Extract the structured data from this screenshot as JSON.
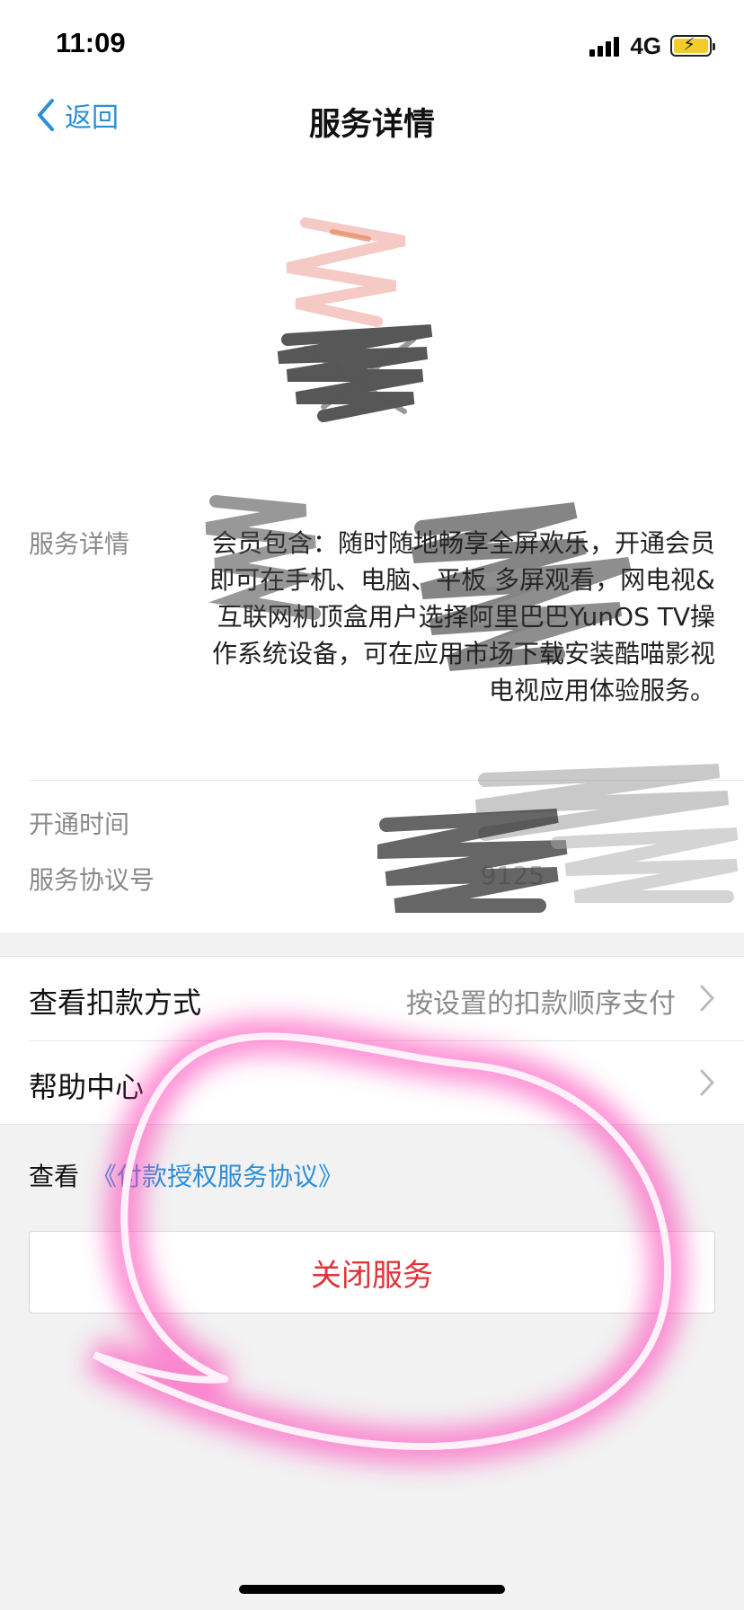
{
  "status_bar": {
    "time": "11:09",
    "network": "4G",
    "battery_state": "charging",
    "battery_color": "#f2cc2a"
  },
  "nav": {
    "back_label": "返回",
    "back_icon": "chevron-left-icon",
    "title": "服务详情"
  },
  "details": {
    "service_details_label": "服务详情",
    "service_details_text": "会员包含：随时随地畅享全屏欢乐，开通会员即可在手机、电脑、平板 多屏观看，网电视&互联网机顶盒用户选择阿里巴巴YunOS TV操作系统设备，可在应用市场下载安装酷喵影视电视应用体验服务。",
    "open_time_label": "开通时间",
    "open_time_value": "",
    "agreement_no_label": "服务协议号",
    "agreement_no_value": "9125"
  },
  "menu": {
    "deduction_label": "查看扣款方式",
    "deduction_value": "按设置的扣款顺序支付",
    "help_label": "帮助中心"
  },
  "agreement": {
    "prefix": "查看",
    "link": "《付款授权服务协议》"
  },
  "close_button": {
    "label": "关闭服务",
    "color": "#e0343a"
  },
  "colors": {
    "accent": "#2b8fd8",
    "highlight": "#ff3fb8"
  }
}
